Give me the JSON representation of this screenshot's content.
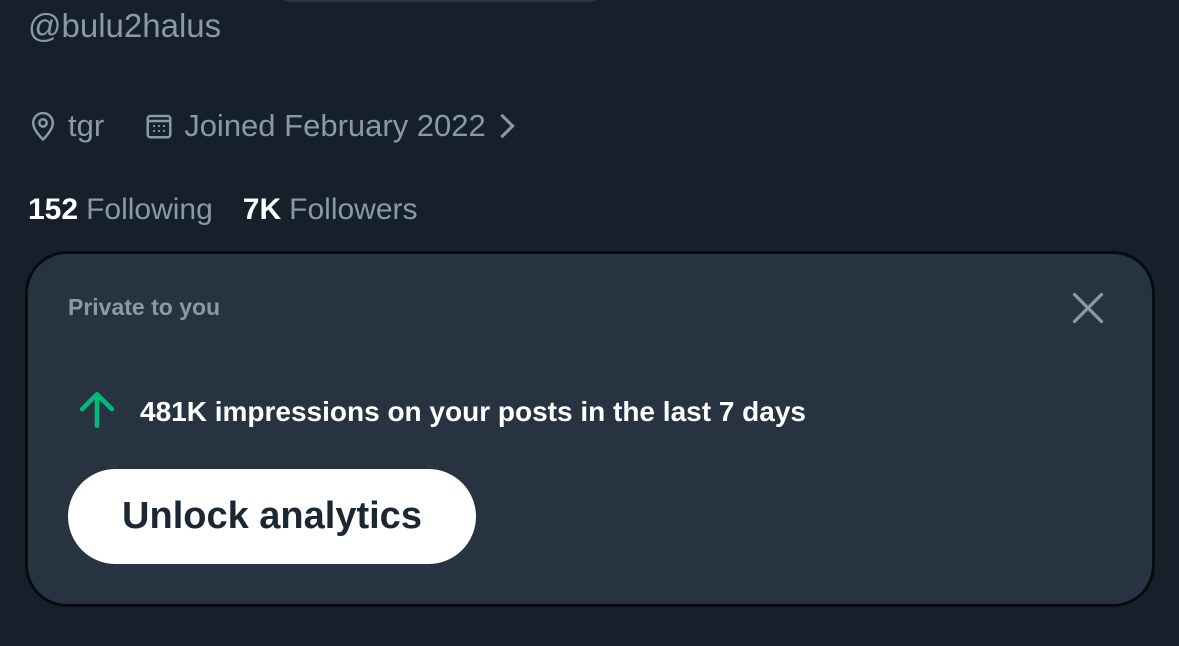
{
  "profile": {
    "handle": "@bulu2halus",
    "location": "tgr",
    "joined": "Joined February 2022",
    "stats": {
      "following_count": "152",
      "following_label": "Following",
      "followers_count": "7K",
      "followers_label": "Followers"
    }
  },
  "analytics_card": {
    "private_label": "Private to you",
    "impressions_text": "481K impressions on your posts in the last 7 days",
    "unlock_button_label": "Unlock analytics"
  },
  "icons": {
    "location": "location-pin-icon",
    "calendar": "calendar-icon",
    "chevron": "chevron-right-icon",
    "close": "close-icon",
    "arrow_up": "arrow-up-icon"
  },
  "colors": {
    "background": "#15202b",
    "card_background": "#273340",
    "secondary_text": "#8b98a5",
    "primary_text": "#ffffff",
    "up_arrow": "#00ba7c",
    "button_background": "#ffffff"
  }
}
